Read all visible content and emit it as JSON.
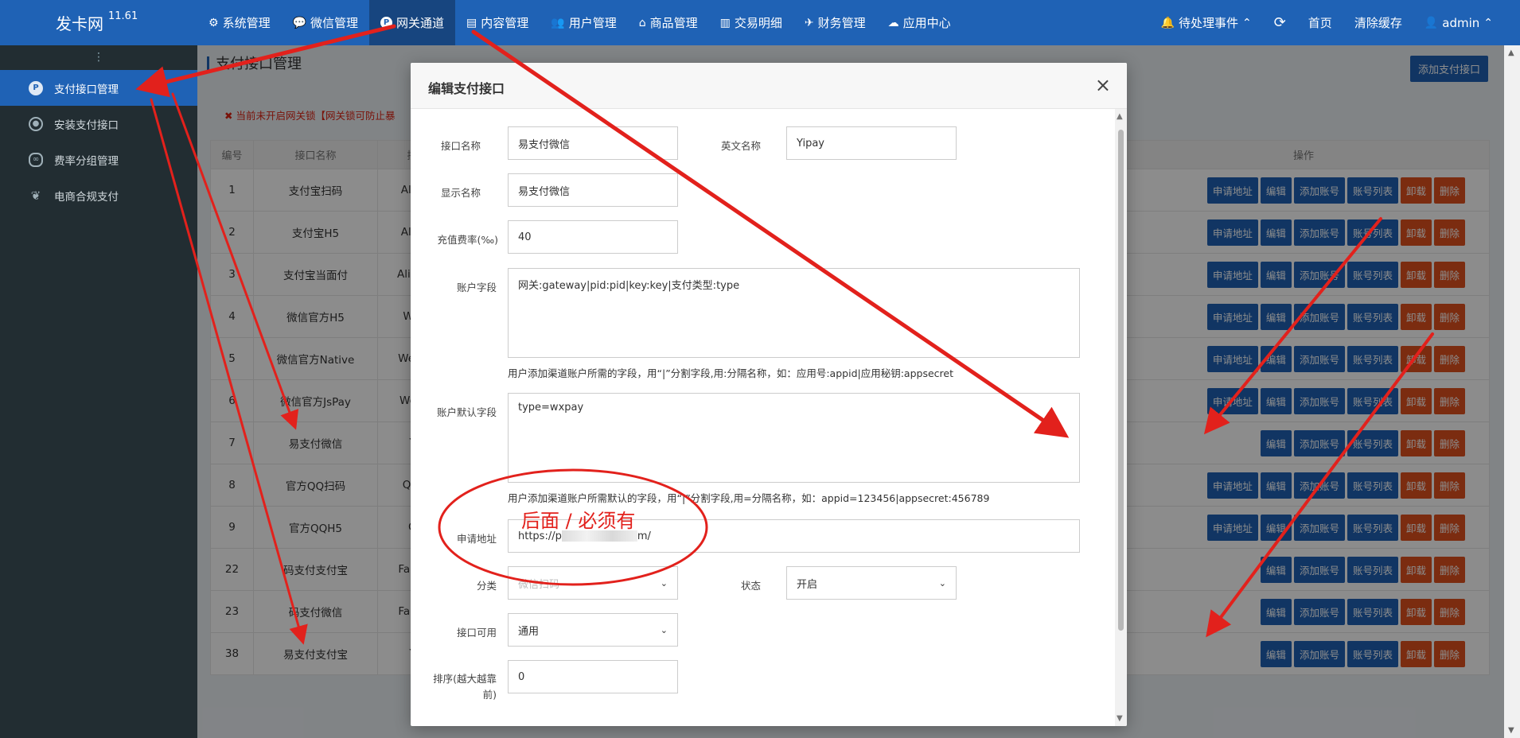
{
  "brand": {
    "name": "发卡网",
    "version": "11.61"
  },
  "nav": [
    {
      "label": "系统管理",
      "icon": "gear-icon"
    },
    {
      "label": "微信管理",
      "icon": "wechat-icon"
    },
    {
      "label": "网关通道",
      "icon": "gateway-icon",
      "active": true
    },
    {
      "label": "内容管理",
      "icon": "document-icon"
    },
    {
      "label": "用户管理",
      "icon": "users-icon"
    },
    {
      "label": "商品管理",
      "icon": "shop-icon"
    },
    {
      "label": "交易明细",
      "icon": "bar-chart-icon"
    },
    {
      "label": "财务管理",
      "icon": "finance-icon"
    },
    {
      "label": "应用中心",
      "icon": "cloud-icon"
    }
  ],
  "nav_right": {
    "pending": "待处理事件",
    "refresh_icon": "refresh-icon",
    "home": "首页",
    "clear_cache": "清除缓存",
    "user": "admin"
  },
  "sidebar": {
    "toggle": "⋮",
    "items": [
      {
        "label": "支付接口管理",
        "active": true
      },
      {
        "label": "安装支付接口"
      },
      {
        "label": "费率分组管理"
      },
      {
        "label": "电商合规支付"
      }
    ]
  },
  "page": {
    "title": "支付接口管理",
    "add_button": "添加支付接口",
    "notice": "当前未开启网关锁【网关锁可防止暴",
    "columns": [
      "编号",
      "接口名称",
      "接口",
      "操作"
    ],
    "rows": [
      {
        "id": "1",
        "name": "支付宝扫码",
        "code": "Alipay",
        "ops": [
          "申请地址",
          "编辑",
          "添加账号",
          "账号列表",
          "卸载",
          "删除"
        ]
      },
      {
        "id": "2",
        "name": "支付宝H5",
        "code": "Alipay",
        "ops": [
          "申请地址",
          "编辑",
          "添加账号",
          "账号列表",
          "卸载",
          "删除"
        ]
      },
      {
        "id": "3",
        "name": "支付宝当面付",
        "code": "AlipayC",
        "ops": [
          "申请地址",
          "编辑",
          "添加账号",
          "账号列表",
          "卸载",
          "删除"
        ]
      },
      {
        "id": "4",
        "name": "微信官方H5",
        "code": "Weixi",
        "ops": [
          "申请地址",
          "编辑",
          "添加账号",
          "账号列表",
          "卸载",
          "删除"
        ]
      },
      {
        "id": "5",
        "name": "微信官方Native",
        "code": "Weixinl",
        "ops": [
          "申请地址",
          "编辑",
          "添加账号",
          "账号列表",
          "卸载",
          "删除"
        ]
      },
      {
        "id": "6",
        "name": "微信官方JsPay",
        "code": "Weixin",
        "ops": [
          "申请地址",
          "编辑",
          "添加账号",
          "账号列表",
          "卸载",
          "删除"
        ]
      },
      {
        "id": "7",
        "name": "易支付微信",
        "code": "Yip",
        "ops": [
          "编辑",
          "添加账号",
          "账号列表",
          "卸载",
          "删除"
        ]
      },
      {
        "id": "8",
        "name": "官方QQ扫码",
        "code": "QqNa",
        "ops": [
          "申请地址",
          "编辑",
          "添加账号",
          "账号列表",
          "卸载",
          "删除"
        ]
      },
      {
        "id": "9",
        "name": "官方QQH5",
        "code": "Qql",
        "ops": [
          "申请地址",
          "编辑",
          "添加账号",
          "账号列表",
          "卸载",
          "删除"
        ]
      },
      {
        "id": "22",
        "name": "码支付支付宝",
        "code": "FakaCo",
        "ops": [
          "编辑",
          "添加账号",
          "账号列表",
          "卸载",
          "删除"
        ]
      },
      {
        "id": "23",
        "name": "码支付微信",
        "code": "FakaCo",
        "ops": [
          "编辑",
          "添加账号",
          "账号列表",
          "卸载",
          "删除"
        ]
      },
      {
        "id": "38",
        "name": "易支付支付宝",
        "code": "Yip",
        "ops": [
          "编辑",
          "添加账号",
          "账号列表",
          "卸载",
          "删除"
        ]
      }
    ]
  },
  "modal": {
    "title": "编辑支付接口",
    "close": "×",
    "fields": {
      "name_label": "接口名称",
      "name_value": "易支付微信",
      "en_label": "英文名称",
      "en_value": "Yipay",
      "display_label": "显示名称",
      "display_value": "易支付微信",
      "rate_label": "充值费率(‰)",
      "rate_value": "40",
      "account_label": "账户字段",
      "account_value": "网关:gateway|pid:pid|key:key|支付类型:type",
      "account_hint": "用户添加渠道账户所需的字段，用“|”分割字段,用:分隔名称，如：应用号:appid|应用秘钥:appsecret",
      "default_label": "账户默认字段",
      "default_value": "type=wxpay",
      "default_hint": "用户添加渠道账户所需默认的字段，用“|”分割字段,用=分隔名称，如：appid=123456|appsecret:456789",
      "apply_label": "申请地址",
      "apply_value_prefix": "https://p",
      "apply_value_suffix": "m/",
      "category_label": "分类",
      "category_value": "微信扫码",
      "status_label": "状态",
      "status_value": "开启",
      "usable_label": "接口可用",
      "usable_value": "通用",
      "sort_label_1": "排序(越大越靠",
      "sort_label_2": "前)",
      "sort_value": "0"
    }
  },
  "annotation": {
    "text": "后面  /  必须有",
    "color": "#e2211c"
  }
}
